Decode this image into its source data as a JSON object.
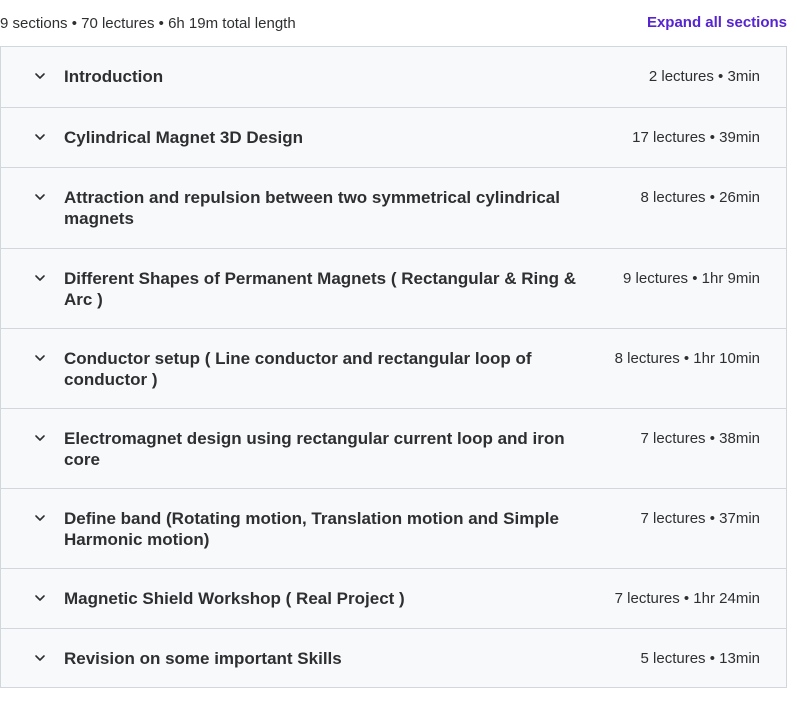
{
  "summary": {
    "text": "9 sections • 70 lectures • 6h 19m total length",
    "expand_all_label": "Expand all sections"
  },
  "sections": [
    {
      "title": "Introduction",
      "meta": "2 lectures • 3min",
      "icon": "chevron-down-icon"
    },
    {
      "title": "Cylindrical Magnet 3D Design",
      "meta": "17 lectures • 39min",
      "icon": "chevron-down-icon"
    },
    {
      "title": "Attraction and repulsion between two symmetrical cylindrical magnets",
      "meta": "8 lectures • 26min",
      "icon": "chevron-down-icon"
    },
    {
      "title": "Different Shapes of Permanent Magnets ( Rectangular & Ring & Arc )",
      "meta": "9 lectures • 1hr 9min",
      "icon": "chevron-down-icon"
    },
    {
      "title": "Conductor setup ( Line conductor and rectangular loop of conductor )",
      "meta": "8 lectures • 1hr 10min",
      "icon": "chevron-down-icon"
    },
    {
      "title": "Electromagnet design using rectangular current loop and iron core",
      "meta": "7 lectures • 38min",
      "icon": "chevron-down-icon"
    },
    {
      "title": "Define band (Rotating motion, Translation motion and Simple Harmonic motion)",
      "meta": "7 lectures • 37min",
      "icon": "chevron-down-icon"
    },
    {
      "title": "Magnetic Shield Workshop ( Real Project )",
      "meta": "7 lectures • 1hr 24min",
      "icon": "chevron-down-icon"
    },
    {
      "title": "Revision on some important Skills",
      "meta": "5 lectures • 13min",
      "icon": "chevron-down-icon"
    }
  ],
  "colors": {
    "accent": "#5624d0",
    "text": "#2d2f31",
    "row_background": "#f7f9fa",
    "border": "#d1d7dc"
  }
}
